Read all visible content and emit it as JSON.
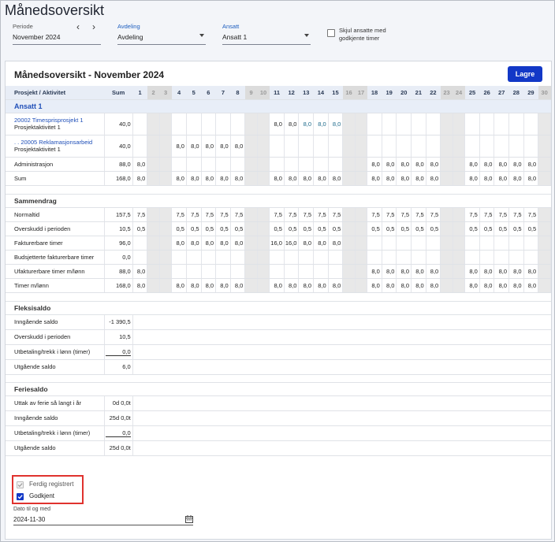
{
  "page_title": "Månedsoversikt",
  "period": {
    "label": "Periode",
    "value": "November 2024"
  },
  "department": {
    "label": "Avdeling",
    "value": "Avdeling"
  },
  "employee": {
    "label": "Ansatt",
    "value": "Ansatt 1"
  },
  "hide_checkbox": {
    "line1": "Skjul ansatte med",
    "line2": "godkjente timer"
  },
  "card_title": "Månedsoversikt - November 2024",
  "save_label": "Lagre",
  "header": {
    "label": "Prosjekt / Aktivitet",
    "sum": "Sum"
  },
  "days": [
    "1",
    "2",
    "3",
    "4",
    "5",
    "6",
    "7",
    "8",
    "9",
    "10",
    "11",
    "12",
    "13",
    "14",
    "15",
    "16",
    "17",
    "18",
    "19",
    "20",
    "21",
    "22",
    "23",
    "24",
    "25",
    "26",
    "27",
    "28",
    "29",
    "30"
  ],
  "weekend": [
    2,
    3,
    9,
    10,
    16,
    17,
    23,
    24,
    30
  ],
  "employee_section": "Ansatt 1",
  "project_rows": [
    {
      "l1": "20002 Timesprisprosjekt 1",
      "l2": "Prosjektaktivitet 1",
      "sum": "40,0",
      "cells": {
        "11": "8,0",
        "12": "8,0",
        "13": "8,0",
        "14": "8,0",
        "15": "8,0"
      },
      "teal": [
        "13",
        "14",
        "15"
      ]
    },
    {
      "l1": ". . 20005 Reklamasjonsarbeid",
      "l2": "Prosjektaktivitet 1",
      "sum": "40,0",
      "cells": {
        "4": "8,0",
        "5": "8,0",
        "6": "8,0",
        "7": "8,0",
        "8": "8,0"
      }
    },
    {
      "label": "Administrasjon",
      "sum": "88,0",
      "cells": {
        "1": "8,0",
        "18": "8,0",
        "19": "8,0",
        "20": "8,0",
        "21": "8,0",
        "22": "8,0",
        "25": "8,0",
        "26": "8,0",
        "27": "8,0",
        "28": "8,0",
        "29": "8,0"
      }
    },
    {
      "label": "Sum",
      "sum": "168,0",
      "cells": {
        "1": "8,0",
        "4": "8,0",
        "5": "8,0",
        "6": "8,0",
        "7": "8,0",
        "8": "8,0",
        "11": "8,0",
        "12": "8,0",
        "13": "8,0",
        "14": "8,0",
        "15": "8,0",
        "18": "8,0",
        "19": "8,0",
        "20": "8,0",
        "21": "8,0",
        "22": "8,0",
        "25": "8,0",
        "26": "8,0",
        "27": "8,0",
        "28": "8,0",
        "29": "8,0"
      }
    }
  ],
  "summary_title": "Sammendrag",
  "summary_rows": [
    {
      "label": "Normaltid",
      "sum": "157,5",
      "cells": {
        "1": "7,5",
        "4": "7,5",
        "5": "7,5",
        "6": "7,5",
        "7": "7,5",
        "8": "7,5",
        "11": "7,5",
        "12": "7,5",
        "13": "7,5",
        "14": "7,5",
        "15": "7,5",
        "18": "7,5",
        "19": "7,5",
        "20": "7,5",
        "21": "7,5",
        "22": "7,5",
        "25": "7,5",
        "26": "7,5",
        "27": "7,5",
        "28": "7,5",
        "29": "7,5"
      }
    },
    {
      "label": "Overskudd i perioden",
      "sum": "10,5",
      "cells": {
        "1": "0,5",
        "4": "0,5",
        "5": "0,5",
        "6": "0,5",
        "7": "0,5",
        "8": "0,5",
        "11": "0,5",
        "12": "0,5",
        "13": "0,5",
        "14": "0,5",
        "15": "0,5",
        "18": "0,5",
        "19": "0,5",
        "20": "0,5",
        "21": "0,5",
        "22": "0,5",
        "25": "0,5",
        "26": "0,5",
        "27": "0,5",
        "28": "0,5",
        "29": "0,5"
      }
    },
    {
      "label": "Fakturerbare timer",
      "sum": "96,0",
      "cells": {
        "4": "8,0",
        "5": "8,0",
        "6": "8,0",
        "7": "8,0",
        "8": "8,0",
        "11": "16,0",
        "12": "16,0",
        "13": "8,0",
        "14": "8,0",
        "15": "8,0"
      }
    },
    {
      "label": "Budsjetterte fakturerbare timer",
      "sum": "0,0",
      "cells": {}
    },
    {
      "label": "Ufakturerbare timer m/lønn",
      "sum": "88,0",
      "cells": {
        "1": "8,0",
        "18": "8,0",
        "19": "8,0",
        "20": "8,0",
        "21": "8,0",
        "22": "8,0",
        "25": "8,0",
        "26": "8,0",
        "27": "8,0",
        "28": "8,0",
        "29": "8,0"
      }
    },
    {
      "label": "Timer m/lønn",
      "sum": "168,0",
      "cells": {
        "1": "8,0",
        "4": "8,0",
        "5": "8,0",
        "6": "8,0",
        "7": "8,0",
        "8": "8,0",
        "11": "8,0",
        "12": "8,0",
        "13": "8,0",
        "14": "8,0",
        "15": "8,0",
        "18": "8,0",
        "19": "8,0",
        "20": "8,0",
        "21": "8,0",
        "22": "8,0",
        "25": "8,0",
        "26": "8,0",
        "27": "8,0",
        "28": "8,0",
        "29": "8,0"
      }
    }
  ],
  "flex_title": "Fleksisaldo",
  "flex_rows": [
    {
      "label": "Inngående saldo",
      "value": "-1 390,5"
    },
    {
      "label": "Overskudd i perioden",
      "value": "10,5"
    },
    {
      "label": "Utbetaling/trekk i lønn (timer)",
      "value": "0,0",
      "input": true
    },
    {
      "label": "Utgående saldo",
      "value": "6,0"
    }
  ],
  "holiday_title": "Feriesaldo",
  "holiday_rows": [
    {
      "label": "Uttak av ferie så langt i år",
      "value": "0d 0,0t"
    },
    {
      "label": "Inngående saldo",
      "value": "25d 0,0t"
    },
    {
      "label": "Utbetaling/trekk i lønn (timer)",
      "value": "0,0",
      "input": true
    },
    {
      "label": "Utgående saldo",
      "value": "25d 0,0t"
    }
  ],
  "status": {
    "finished": "Ferdig registrert",
    "approved": "Godkjent"
  },
  "date": {
    "label": "Dato til og med",
    "value": "2024-11-30"
  },
  "colors": {
    "accent": "#1238c7",
    "highlight": "#e0322e"
  }
}
